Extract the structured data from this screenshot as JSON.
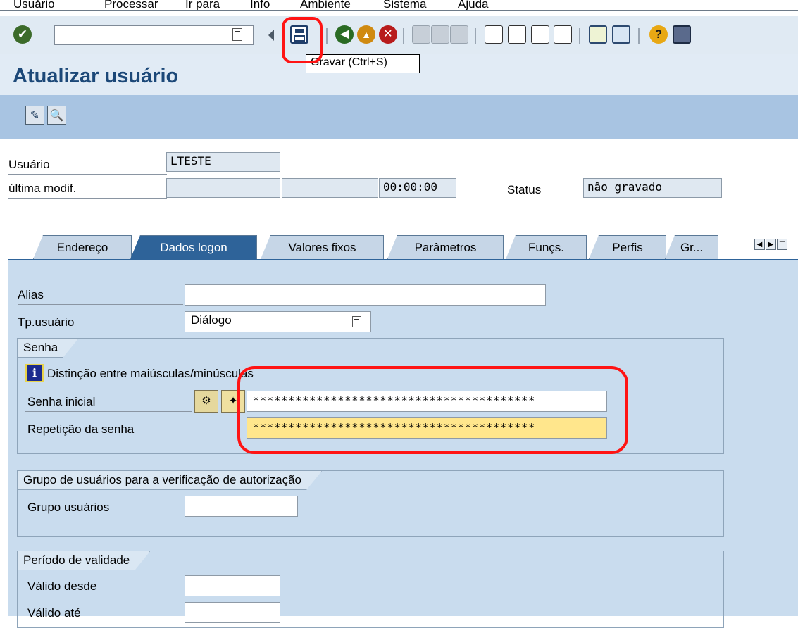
{
  "menu": {
    "items": [
      "Usuário",
      "Processar",
      "Ir para",
      "Info",
      "Ambiente",
      "Sistema",
      "Ajuda"
    ]
  },
  "toolbar": {
    "save_tooltip": "Gravar  (Ctrl+S)"
  },
  "page": {
    "title": "Atualizar usuário"
  },
  "header": {
    "user_label": "Usuário",
    "user_value": "LTESTE",
    "last_change_label": "última modif.",
    "last_change_date": "",
    "last_change_user": "",
    "last_change_time": "00:00:00",
    "status_label": "Status",
    "status_value": "não gravado"
  },
  "tabs": [
    {
      "label": "Endereço",
      "active": false
    },
    {
      "label": "Dados logon",
      "active": true
    },
    {
      "label": "Valores fixos",
      "active": false
    },
    {
      "label": "Parâmetros",
      "active": false
    },
    {
      "label": "Funçs.",
      "active": false
    },
    {
      "label": "Perfis",
      "active": false
    },
    {
      "label": "Gr...",
      "active": false
    }
  ],
  "logon": {
    "alias_label": "Alias",
    "alias_value": "",
    "user_type_label": "Tp.usuário",
    "user_type_value": "Diálogo"
  },
  "password_group": {
    "title": "Senha",
    "info_text": "Distinção entre maiúsculas/minúsculas",
    "initial_label": "Senha inicial",
    "initial_value": "****************************************",
    "repeat_label": "Repetição da senha",
    "repeat_value": "****************************************"
  },
  "auth_group": {
    "title": "Grupo de usuários para a verificação de autorização",
    "group_label": "Grupo usuários",
    "group_value": ""
  },
  "validity_group": {
    "title": "Período de validade",
    "from_label": "Válido desde",
    "from_value": "",
    "to_label": "Válido até",
    "to_value": ""
  },
  "colors": {
    "title": "#1c4878",
    "active_tab": "#2e6399",
    "highlight": "#ff1414",
    "required_field": "#ffe68c"
  }
}
